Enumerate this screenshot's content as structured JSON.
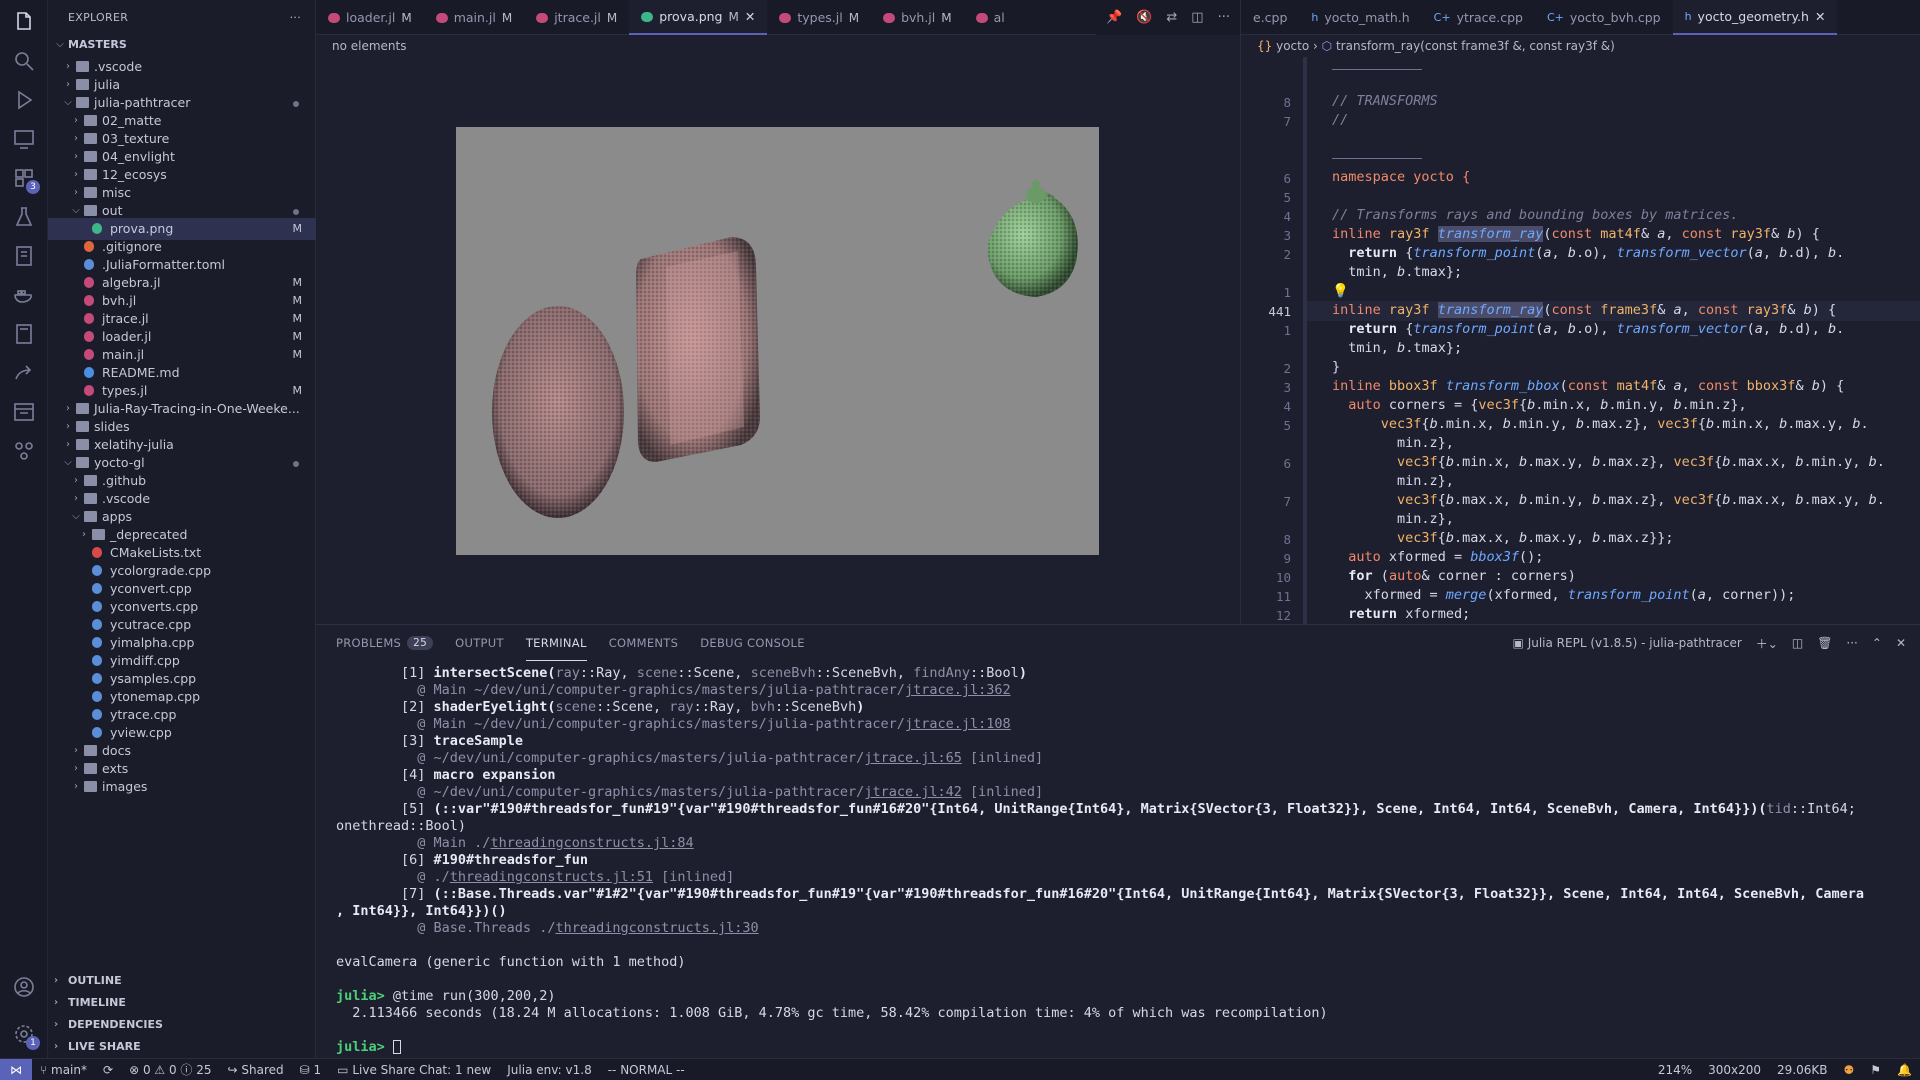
{
  "sidebar": {
    "title": "EXPLORER",
    "more": "···",
    "root": "MASTERS",
    "items": [
      {
        "label": ".vscode",
        "depth": 1,
        "type": "folder",
        "open": false
      },
      {
        "label": "julia",
        "depth": 1,
        "type": "folder",
        "open": false
      },
      {
        "label": "julia-pathtracer",
        "depth": 1,
        "type": "folder",
        "open": true,
        "dot": true
      },
      {
        "label": "02_matte",
        "depth": 2,
        "type": "folder",
        "open": false
      },
      {
        "label": "03_texture",
        "depth": 2,
        "type": "folder",
        "open": false
      },
      {
        "label": "04_envlight",
        "depth": 2,
        "type": "folder",
        "open": false
      },
      {
        "label": "12_ecosys",
        "depth": 2,
        "type": "folder",
        "open": false
      },
      {
        "label": "misc",
        "depth": 2,
        "type": "folder",
        "open": false
      },
      {
        "label": "out",
        "depth": 2,
        "type": "folder",
        "open": true,
        "dot": true
      },
      {
        "label": "prova.png",
        "depth": 3,
        "type": "file",
        "color": "#3fb58a",
        "badge": "M",
        "selected": true
      },
      {
        "label": ".gitignore",
        "depth": 2,
        "type": "file",
        "color": "#e0663d"
      },
      {
        "label": ".JuliaFormatter.toml",
        "depth": 2,
        "type": "file",
        "color": "#5a8fd8"
      },
      {
        "label": "algebra.jl",
        "depth": 2,
        "type": "file",
        "color": "#c44a7a",
        "badge": "M"
      },
      {
        "label": "bvh.jl",
        "depth": 2,
        "type": "file",
        "color": "#c44a7a",
        "badge": "M"
      },
      {
        "label": "jtrace.jl",
        "depth": 2,
        "type": "file",
        "color": "#c44a7a",
        "badge": "M"
      },
      {
        "label": "loader.jl",
        "depth": 2,
        "type": "file",
        "color": "#c44a7a",
        "badge": "M"
      },
      {
        "label": "main.jl",
        "depth": 2,
        "type": "file",
        "color": "#c44a7a",
        "badge": "M"
      },
      {
        "label": "README.md",
        "depth": 2,
        "type": "file",
        "color": "#4a8fe0"
      },
      {
        "label": "types.jl",
        "depth": 2,
        "type": "file",
        "color": "#c44a7a",
        "badge": "M"
      },
      {
        "label": "Julia-Ray-Tracing-in-One-Weeke...",
        "depth": 1,
        "type": "folder",
        "open": false
      },
      {
        "label": "slides",
        "depth": 1,
        "type": "folder",
        "open": false
      },
      {
        "label": "xelatihy-julia",
        "depth": 1,
        "type": "folder",
        "open": false
      },
      {
        "label": "yocto-gl",
        "depth": 1,
        "type": "folder",
        "open": true,
        "dot": true
      },
      {
        "label": ".github",
        "depth": 2,
        "type": "folder",
        "open": false
      },
      {
        "label": ".vscode",
        "depth": 2,
        "type": "folder",
        "open": false
      },
      {
        "label": "apps",
        "depth": 2,
        "type": "folder",
        "open": true
      },
      {
        "label": "_deprecated",
        "depth": 3,
        "type": "folder",
        "open": false
      },
      {
        "label": "CMakeLists.txt",
        "depth": 3,
        "type": "file",
        "color": "#d84a4a"
      },
      {
        "label": "ycolorgrade.cpp",
        "depth": 3,
        "type": "file",
        "color": "#5a8fd8"
      },
      {
        "label": "yconvert.cpp",
        "depth": 3,
        "type": "file",
        "color": "#5a8fd8"
      },
      {
        "label": "yconverts.cpp",
        "depth": 3,
        "type": "file",
        "color": "#5a8fd8"
      },
      {
        "label": "ycutrace.cpp",
        "depth": 3,
        "type": "file",
        "color": "#5a8fd8"
      },
      {
        "label": "yimalpha.cpp",
        "depth": 3,
        "type": "file",
        "color": "#5a8fd8"
      },
      {
        "label": "yimdiff.cpp",
        "depth": 3,
        "type": "file",
        "color": "#5a8fd8"
      },
      {
        "label": "ysamples.cpp",
        "depth": 3,
        "type": "file",
        "color": "#5a8fd8"
      },
      {
        "label": "ytonemap.cpp",
        "depth": 3,
        "type": "file",
        "color": "#5a8fd8"
      },
      {
        "label": "ytrace.cpp",
        "depth": 3,
        "type": "file",
        "color": "#5a8fd8"
      },
      {
        "label": "yview.cpp",
        "depth": 3,
        "type": "file",
        "color": "#5a8fd8"
      },
      {
        "label": "docs",
        "depth": 2,
        "type": "folder",
        "open": false
      },
      {
        "label": "exts",
        "depth": 2,
        "type": "folder",
        "open": false
      },
      {
        "label": "images",
        "depth": 2,
        "type": "folder",
        "open": false
      }
    ],
    "sections": [
      "OUTLINE",
      "TIMELINE",
      "DEPENDENCIES",
      "LIVE SHARE"
    ]
  },
  "activity_bar": {
    "icons": [
      "explorer-icon",
      "search-icon",
      "run-debug-icon",
      "remote-explorer-icon",
      "extensions-icon",
      "testing-icon",
      "julia-icon",
      "docker-icon",
      "notebook-icon",
      "live-share-icon",
      "timeline-icon",
      "source-control-graph-icon"
    ],
    "extensions_badge": "3",
    "settings_badge": "1"
  },
  "editor_left": {
    "tabs": [
      {
        "label": "loader.jl",
        "mod": "M",
        "color": "#c44a7a"
      },
      {
        "label": "main.jl",
        "mod": "M",
        "color": "#c44a7a"
      },
      {
        "label": "jtrace.jl",
        "mod": "M",
        "color": "#c44a7a"
      },
      {
        "label": "prova.png",
        "mod": "M",
        "color": "#3fb58a",
        "active": true
      },
      {
        "label": "types.jl",
        "mod": "M",
        "color": "#c44a7a"
      },
      {
        "label": "bvh.jl",
        "mod": "M",
        "color": "#c44a7a"
      },
      {
        "label": "al",
        "mod": "",
        "color": "#c44a7a"
      }
    ],
    "breadcrumb": "no elements"
  },
  "editor_right": {
    "tabs": [
      {
        "label": "e.cpp",
        "prefix": ""
      },
      {
        "label": "yocto_math.h",
        "prefix": "h"
      },
      {
        "label": "ytrace.cpp",
        "prefix": "C+"
      },
      {
        "label": "yocto_bvh.cpp",
        "prefix": "C+"
      },
      {
        "label": "yocto_geometry.h",
        "prefix": "h",
        "active": true
      }
    ],
    "breadcrumb_ns": "yocto",
    "breadcrumb_fn": "transform_ray(const frame3f &, const ray3f &)",
    "cursor_line": "441"
  },
  "panel": {
    "tabs": [
      "PROBLEMS",
      "OUTPUT",
      "TERMINAL",
      "COMMENTS",
      "DEBUG CONSOLE"
    ],
    "problems_count": "25",
    "active_tab": "TERMINAL",
    "terminal_name": "Julia REPL (v1.8.5) - julia-pathtracer",
    "eval_msg": "evalCamera (generic function with 1 method)",
    "prompt": "julia>",
    "command": "@time run(300,200,2)",
    "timing": "  2.113466 seconds (18.24 M allocations: 1.008 GiB, 4.78% gc time, 58.42% compilation time: 4% of which was recompilation)"
  },
  "status": {
    "branch": "main*",
    "errors": "0",
    "warnings": "0",
    "infos": "25",
    "shared": "Shared",
    "ports": "1",
    "live_share_chat": "Live Share Chat: 1 new",
    "julia_env": "Julia env: v1.8",
    "vim_mode": "-- NORMAL --",
    "zoom": "214%",
    "dims": "300x200",
    "size": "29.06KB"
  },
  "colors": {
    "accent": "#5b63b8",
    "background": "#1e1f2e",
    "sidebar": "#1b1c2a"
  }
}
